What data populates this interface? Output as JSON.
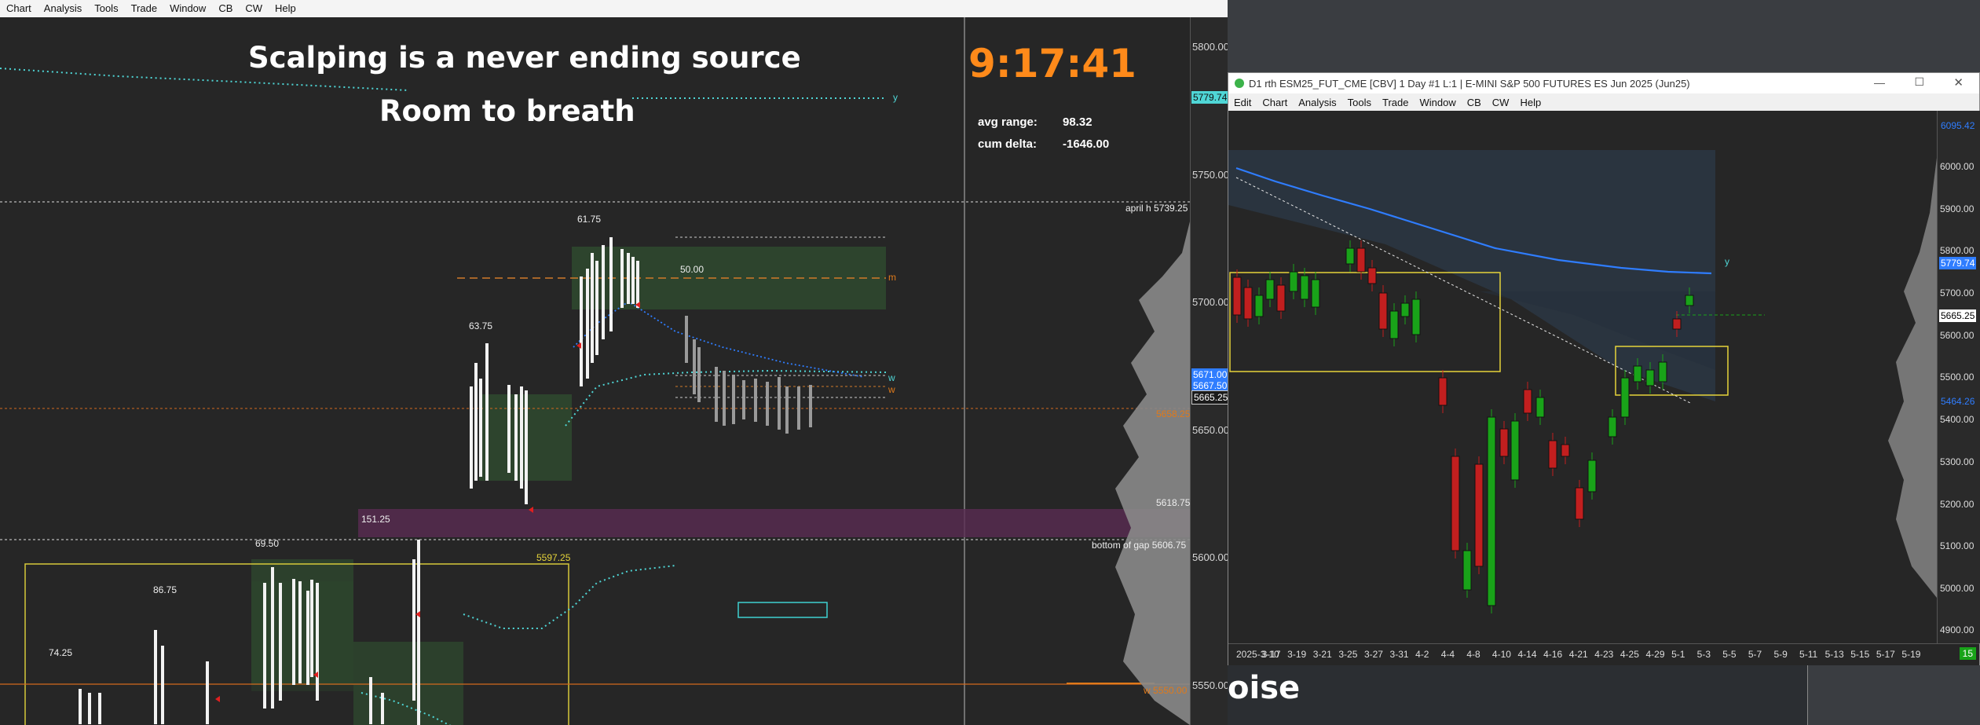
{
  "menubar": {
    "items": [
      "Chart",
      "Analysis",
      "Tools",
      "Trade",
      "Window",
      "CB",
      "CW",
      "Help"
    ]
  },
  "left": {
    "headline1": "Scalping is a never ending source",
    "headline2": "Room to breath",
    "clock": "9:17:41",
    "stats": {
      "avg_range_label": "avg range:",
      "avg_range_value": "98.32",
      "cum_delta_label": "cum delta:",
      "cum_delta_value": "-1646.00"
    },
    "bar_labels": [
      "61.75",
      "50.00",
      "63.75",
      "151.25",
      "69.50",
      "86.75",
      "74.25"
    ],
    "level_5597": "5597.25",
    "line_tags": [
      "y",
      "m",
      "w",
      "w"
    ],
    "level_labels": {
      "april_h": "april h",
      "april_h_val": "5739.25",
      "v5658": "5658.25",
      "v5618": "5618.75",
      "bottom_gap": "bottom of gap",
      "bottom_gap_val": "5606.75",
      "w_label": "w",
      "w_val": "5550.00"
    },
    "axis": {
      "ticks": [
        "5800.00",
        "5750.00",
        "5700.00",
        "5650.00",
        "5600.00",
        "5550.00"
      ],
      "tag_top": "5779.74",
      "tag_mid1": "5671.00",
      "tag_mid2": "5667.50",
      "tag_mid3": "5665.25"
    }
  },
  "window": {
    "title": "D1 rth ESM25_FUT_CME [CBV]  1 Day  #1 L:1 | E-MINI S&P 500 FUTURES ES Jun 2025 (Jun25)",
    "menu": [
      "Edit",
      "Chart",
      "Analysis",
      "Tools",
      "Trade",
      "Window",
      "CB",
      "CW",
      "Help"
    ],
    "axis": {
      "ticks": [
        "6000.00",
        "5900.00",
        "5800.00",
        "5700.00",
        "5600.00",
        "5500.00",
        "5400.00",
        "5300.00",
        "5200.00",
        "5100.00",
        "5000.00",
        "4900.00"
      ],
      "tag_6095": "6095.42",
      "tag_5780": "5779.74",
      "tag_5665": "5665.25",
      "tag_5464": "5464.26"
    },
    "x_labels": [
      "2025-3-10",
      "3-17",
      "3-19",
      "3-21",
      "3-25",
      "3-27",
      "3-31",
      "4-2",
      "4-4",
      "4-8",
      "4-10",
      "4-14",
      "4-16",
      "4-21",
      "4-23",
      "4-25",
      "4-29",
      "5-1",
      "5-3",
      "5-5",
      "5-7",
      "5-9",
      "5-11",
      "5-13",
      "5-15",
      "5-17",
      "5-19"
    ],
    "corner_tag": "15",
    "y_tag": "y"
  },
  "below": {
    "fragment": "oise"
  },
  "colors": {
    "accent_orange": "#ff8a1a",
    "cyan": "#4fd6d6",
    "ma_blue": "#2f7dff",
    "bull": "#19a319",
    "bear": "#c21f1f"
  }
}
